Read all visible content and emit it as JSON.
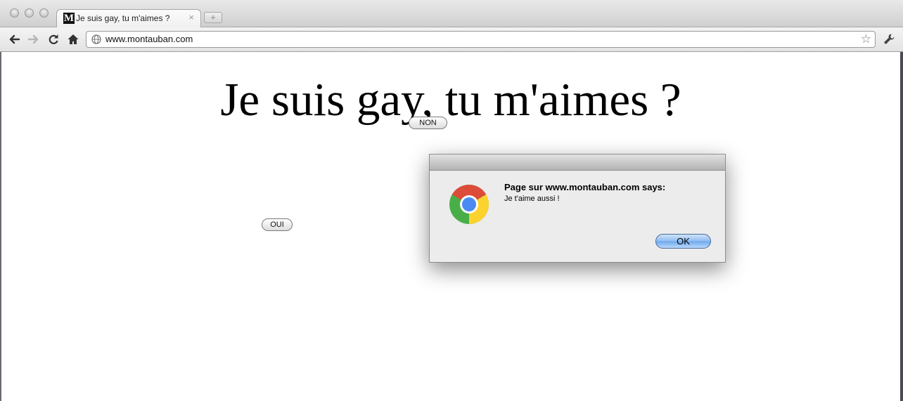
{
  "browser": {
    "tab": {
      "favicon_letter": "M",
      "title": "Je suis gay, tu m'aimes ?",
      "close_glyph": "×"
    },
    "new_tab_glyph": "+",
    "toolbar": {
      "back_icon": "back-arrow-icon",
      "forward_icon": "forward-arrow-icon",
      "reload_icon": "reload-icon",
      "home_icon": "home-icon",
      "address": "www.montauban.com",
      "bookmark_icon": "star-icon",
      "menu_icon": "wrench-icon"
    }
  },
  "page": {
    "headline": "Je suis gay, tu m'aimes ?",
    "buttons": {
      "non": "NON",
      "oui": "OUI"
    }
  },
  "dialog": {
    "heading": "Page sur www.montauban.com says:",
    "message": "Je t'aime aussi !",
    "ok_label": "OK",
    "icon": "chrome-logo-icon"
  },
  "colors": {
    "ok_button": "#8fbcf0",
    "page_background": "#ffffff"
  }
}
